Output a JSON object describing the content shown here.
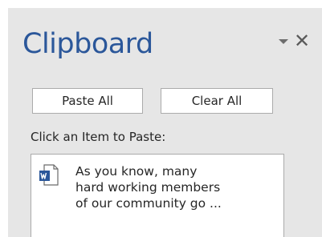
{
  "pane": {
    "title": "Clipboard",
    "menu_icon": "triangle-down-icon",
    "close_glyph": "✕"
  },
  "buttons": {
    "paste_all": "Paste All",
    "clear_all": "Clear All"
  },
  "hint": "Click an Item to Paste:",
  "items": [
    {
      "icon": "word-document-icon",
      "text": "As you know, many\nhard working members\nof our community go ..."
    }
  ],
  "colors": {
    "title": "#2b579a",
    "word_blue": "#2b579a",
    "pane_bg": "#e6e6e6"
  }
}
